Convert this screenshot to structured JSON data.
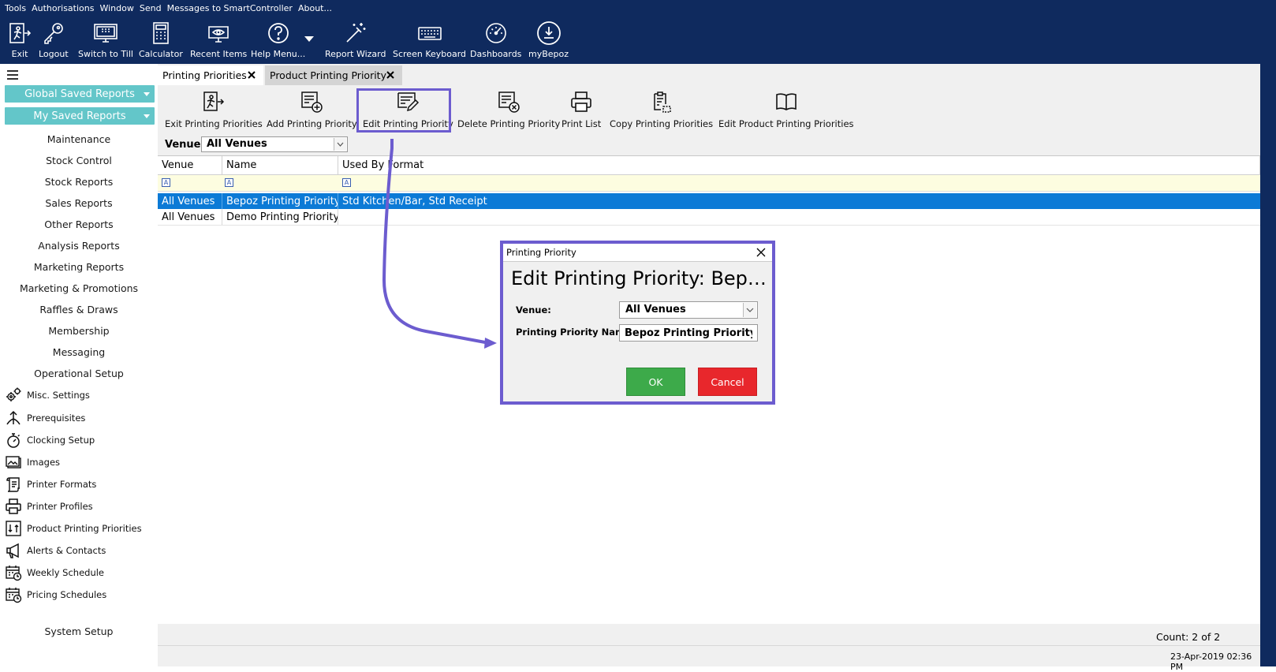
{
  "menu": [
    "Tools",
    "Authorisations",
    "Window",
    "Send",
    "Messages to SmartController",
    "About..."
  ],
  "toolbar": {
    "exit": "Exit",
    "logout": "Logout",
    "switch_to_till": "Switch to Till",
    "calculator": "Calculator",
    "recent_items": "Recent Items",
    "help_menu": "Help Menu...",
    "report_wizard": "Report Wizard",
    "screen_keyboard": "Screen Keyboard",
    "dashboards": "Dashboards",
    "mybepoz": "myBepoz"
  },
  "sidebar": {
    "global_saved": "Global Saved Reports",
    "my_saved": "My Saved Reports",
    "sections": [
      "Maintenance",
      "Stock Control",
      "Stock Reports",
      "Sales Reports",
      "Other Reports",
      "Analysis Reports",
      "Marketing Reports",
      "Marketing & Promotions",
      "Raffles & Draws",
      "Membership",
      "Messaging",
      "Operational Setup"
    ],
    "items": [
      "Misc. Settings",
      "Prerequisites",
      "Clocking Setup",
      "Images",
      "Printer Formats",
      "Printer Profiles",
      "Product Printing Priorities",
      "Alerts & Contacts",
      "Weekly Schedule",
      "Pricing Schedules"
    ],
    "system_setup": "System Setup"
  },
  "tabs": [
    "Printing Priorities",
    "Product Printing Priority"
  ],
  "ribbon": {
    "exit": "Exit Printing Priorities",
    "add": "Add Printing Priority",
    "edit": "Edit Printing Priority",
    "delete": "Delete Printing Priority",
    "print": "Print List",
    "copy": "Copy Printing Priorities",
    "edit_product": "Edit Product Printing Priorities"
  },
  "filter": {
    "venue_label": "Venue:",
    "venue_value": "All Venues"
  },
  "grid": {
    "columns": [
      "Venue",
      "Name",
      "Used By Format"
    ],
    "filter_glyph": "A",
    "rows": [
      [
        "All Venues",
        "Bepoz Printing Priority",
        "Std Kitchen/Bar, Std Receipt"
      ],
      [
        "All Venues",
        "Demo Printing Priority",
        ""
      ]
    ]
  },
  "status": {
    "count": "Count: 2 of 2",
    "datetime": "23-Apr-2019  02:36 PM"
  },
  "dialog": {
    "title": "Printing Priority",
    "heading": "Edit Printing Priority: Bepoz Printing Priority",
    "venue_label": "Venue:",
    "venue_value": "All Venues",
    "name_label": "Printing Priority Name:",
    "name_value": "Bepoz Printing Priority",
    "ok": "OK",
    "cancel": "Cancel"
  },
  "colors": {
    "topbar": "#0f2a5e",
    "saved_button": "#63c6c9",
    "selection": "#0c7ad6",
    "highlight": "#6c5ccf",
    "ok": "#3daa4a",
    "cancel": "#e8272c"
  }
}
